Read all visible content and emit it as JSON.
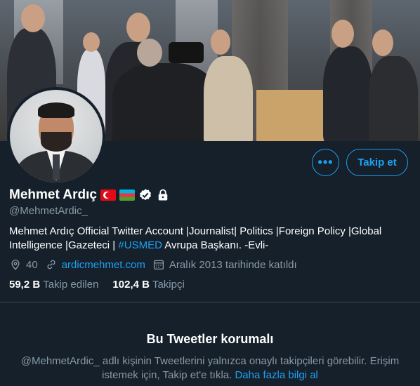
{
  "profile": {
    "name": "Mehmet Ardıç",
    "handle": "@MehmetArdic_",
    "bio_text": "Mehmet Ardıç Official Twitter Account |Journalist| Politics |Foreign Policy |Global Intelligence |Gazeteci | ",
    "bio_hashtag": "#USMED",
    "bio_tail": " Avrupa Başkanı. -Evli-",
    "location": "40",
    "website": "ardicmehmet.com",
    "joined": "Aralık 2013 tarihinde katıldı"
  },
  "stats": {
    "following_count": "59,2 B",
    "following_label": "Takip edilen",
    "followers_count": "102,4 B",
    "followers_label": "Takipçi"
  },
  "actions": {
    "more_label": "•••",
    "follow_label": "Takip et"
  },
  "protected": {
    "title": "Bu Tweetler korumalı",
    "text": "@MehmetArdic_ adlı kişinin Tweetlerini yalnızca onaylı takipçileri görebilir. Erişim istemek için, Takip et'e tıkla. ",
    "link": "Daha fazla bilgi al"
  },
  "colors": {
    "background": "#15202b",
    "accent": "#1da1f2",
    "secondary_text": "#8899a6",
    "divider": "#38444d"
  },
  "icons": {
    "verified": "verified-badge-icon",
    "protected": "lock-icon",
    "location": "location-pin-icon",
    "link": "link-icon",
    "calendar": "calendar-icon"
  }
}
